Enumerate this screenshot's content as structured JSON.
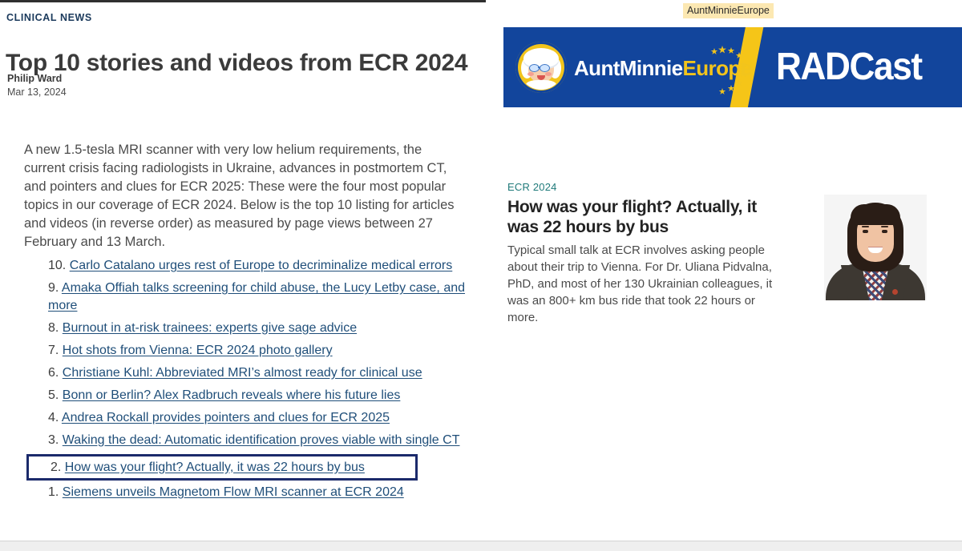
{
  "article": {
    "kicker": "CLINICAL NEWS",
    "headline": "Top 10 stories and videos from ECR 2024",
    "author": "Philip Ward",
    "date": "Mar 13, 2024",
    "lede": "A new 1.5-tesla MRI scanner with very low helium requirements, the current crisis facing radiologists in Ukraine, advances in postmortem CT, and pointers and clues for ECR 2025: These were the four most popular topics in our coverage of ECR 2024. Below is the top 10 listing for articles and videos (in reverse order) as measured by page views between 27 February and 13 March.",
    "list": [
      {
        "number": "10.",
        "label": "Carlo Catalano urges rest of Europe to decriminalize medical errors",
        "highlighted": false
      },
      {
        "number": "9.",
        "label": "Amaka Offiah talks screening for child abuse, the Lucy Letby case, and more",
        "highlighted": false
      },
      {
        "number": "8.",
        "label": "Burnout in at-risk trainees: experts give sage advice",
        "highlighted": false
      },
      {
        "number": "7.",
        "label": "Hot shots from Vienna: ECR 2024 photo gallery",
        "highlighted": false
      },
      {
        "number": "6.",
        "label": "Christiane Kuhl: Abbreviated MRI’s almost ready for clinical use",
        "highlighted": false
      },
      {
        "number": "5.",
        "label": "Bonn or Berlin? Alex Radbruch reveals where his future lies",
        "highlighted": false
      },
      {
        "number": "4.",
        "label": "Andrea Rockall provides pointers and clues for ECR 2025",
        "highlighted": false
      },
      {
        "number": "3.",
        "label": "Waking the dead: Automatic identification proves viable with single CT",
        "highlighted": false
      },
      {
        "number": "2.",
        "label": "How was your flight? Actually, it was 22 hours by bus",
        "highlighted": true
      },
      {
        "number": "1.",
        "label": "Siemens unveils Magnetom Flow MRI scanner at ECR 2024",
        "highlighted": false
      }
    ]
  },
  "tooltip": {
    "text": "AuntMinnieEurope"
  },
  "banner": {
    "logo_aunt": "AuntMinnie",
    "logo_europe": "Europe",
    "show_title": "RADCast",
    "background_color": "#12459c",
    "slash_color": "#f5c518",
    "accent_color": "#f2c41c"
  },
  "feature_card": {
    "tag": "ECR 2024",
    "tag_color": "#1f7a7a",
    "title": "How was your flight? Actually, it was 22 hours by bus",
    "summary": "Typical small talk at ECR involves asking people about their trip to Vienna. For Dr. Uliana Pidvalna, PhD, and most of her 130 Ukrainian colleagues, it was an 800+ km bus ride that took 22 hours or more."
  },
  "colors": {
    "link": "#1f4e79",
    "kicker": "#1b3a5c",
    "highlight_border": "#1b2a6b"
  }
}
